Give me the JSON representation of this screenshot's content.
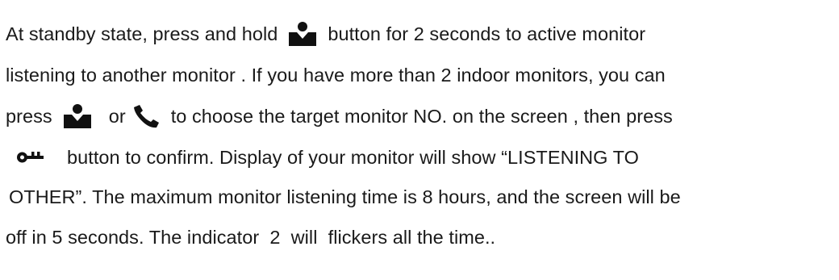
{
  "paragraph": {
    "line1": {
      "before_icon": "At standby state, press and hold",
      "icon": "person-monitor-icon",
      "after_icon": "button for 2 seconds to active monitor"
    },
    "line2": {
      "text": "listening to another monitor . If you have more than 2 indoor monitors, you can"
    },
    "line3": {
      "before_icon": "press",
      "icon_a": "person-monitor-icon",
      "middle": "or",
      "icon_b": "handset-icon",
      "after_icon": "to choose the target monitor NO. on the screen , then press"
    },
    "line4": {
      "icon": "key-icon",
      "after_icon": "button to confirm. Display of your monitor will show “LISTENING TO"
    },
    "line5": {
      "text": "OTHER”. The maximum monitor listening time is 8 hours, and the screen will be"
    },
    "line6": {
      "text": "off in 5 seconds. The indicator  2  will  flickers all the time.."
    }
  },
  "colors": {
    "text": "#1a1a1a",
    "icon": "#111111",
    "background": "#ffffff"
  }
}
